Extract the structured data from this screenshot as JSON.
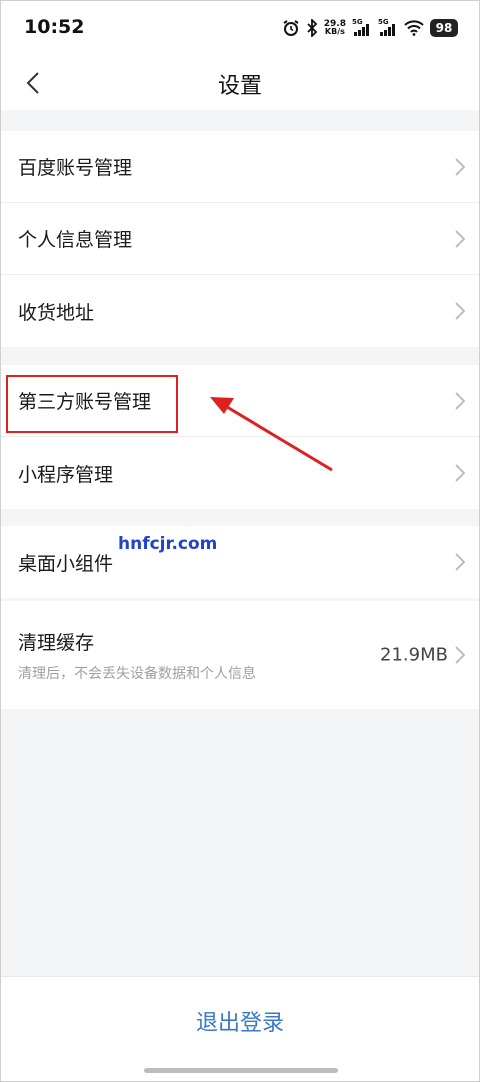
{
  "status_bar": {
    "time": "10:52",
    "net_speed_value": "29.8",
    "net_speed_unit": "KB/s",
    "signal1_label": "5G",
    "signal2_label": "5G",
    "battery": "98",
    "icons": [
      "alarm-icon",
      "bluetooth-icon",
      "signal-icon",
      "wifi-icon",
      "battery-icon"
    ]
  },
  "header": {
    "title": "设置",
    "back_icon": "chevron-left-icon"
  },
  "groups": [
    {
      "items": [
        {
          "label": "百度账号管理"
        },
        {
          "label": "个人信息管理"
        },
        {
          "label": "收货地址"
        }
      ]
    },
    {
      "items": [
        {
          "label": "第三方账号管理"
        },
        {
          "label": "小程序管理"
        }
      ]
    },
    {
      "items": [
        {
          "label": "桌面小组件"
        }
      ]
    },
    {
      "items": [
        {
          "label": "清理缓存",
          "subtitle": "清理后，不会丢失设备数据和个人信息",
          "value": "21.9MB"
        }
      ]
    }
  ],
  "annotation": {
    "highlight_color": "#e02020"
  },
  "watermark": "hnfcjr.com",
  "footer": {
    "logout_label": "退出登录",
    "logout_color": "#3a78c9"
  }
}
